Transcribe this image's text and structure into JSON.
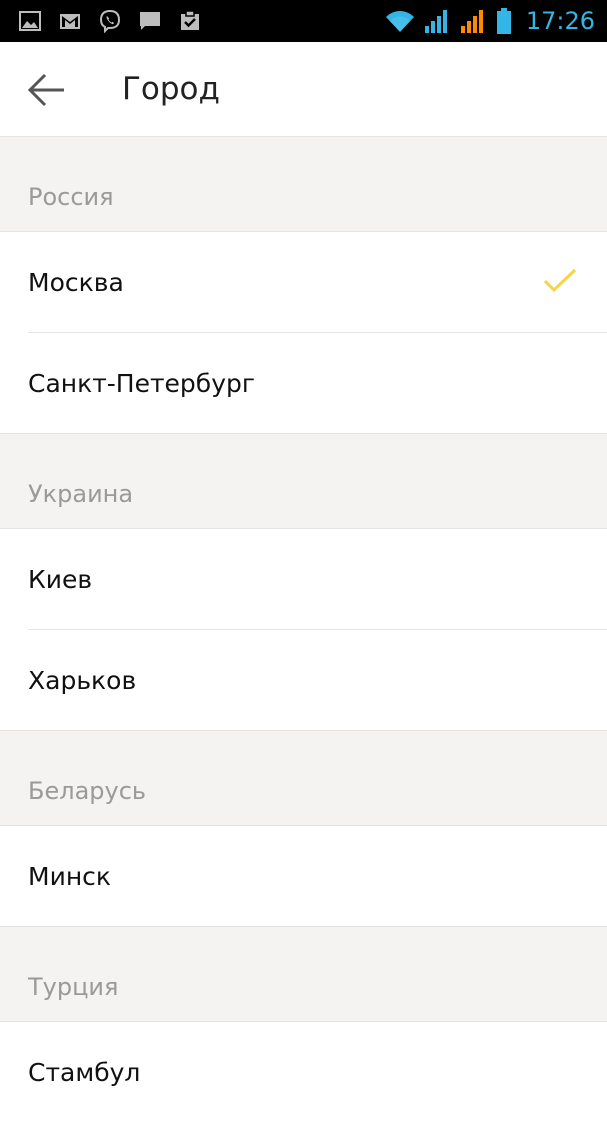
{
  "status_bar": {
    "left_icons": [
      "gallery-icon",
      "gmail-icon",
      "viber-icon",
      "message-icon",
      "task-icon"
    ],
    "right_icons": [
      "wifi-icon",
      "signal-sim1-icon",
      "signal-sim2-icon",
      "battery-icon"
    ],
    "time": "17:26",
    "colors": {
      "background": "#000000",
      "accent": "#33b5e5",
      "signal_secondary": "#ff8a00"
    }
  },
  "app_bar": {
    "back_icon": "arrow-left-icon",
    "title": "Город"
  },
  "sections": [
    {
      "country": "Россия",
      "cities": [
        {
          "name": "Москва",
          "selected": true
        },
        {
          "name": "Санкт-Петербург",
          "selected": false
        }
      ]
    },
    {
      "country": "Украина",
      "cities": [
        {
          "name": "Киев",
          "selected": false
        },
        {
          "name": "Харьков",
          "selected": false
        }
      ]
    },
    {
      "country": "Беларусь",
      "cities": [
        {
          "name": "Минск",
          "selected": false
        }
      ]
    },
    {
      "country": "Турция",
      "cities": [
        {
          "name": "Стамбул",
          "selected": false
        }
      ]
    }
  ],
  "selected_icon": "checkmark-icon",
  "colors": {
    "checkmark": "#f7d345",
    "section_background": "#f4f3f1",
    "section_text": "#9b9a97",
    "item_text": "#111111"
  }
}
